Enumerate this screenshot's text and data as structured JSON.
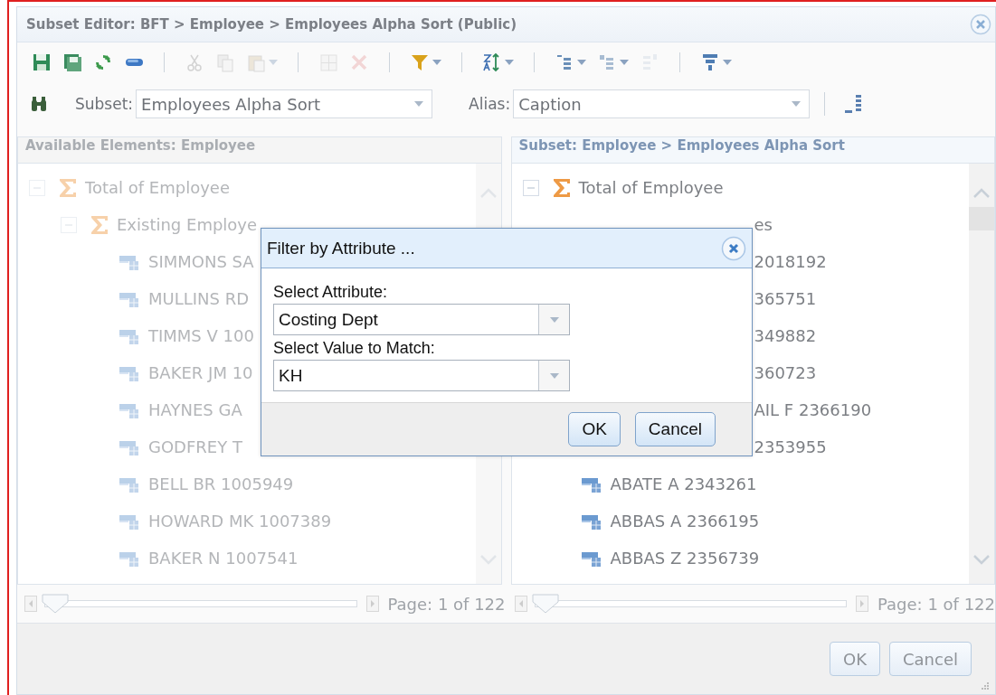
{
  "window": {
    "title": "Subset Editor: BFT > Employee > Employees Alpha Sort (Public)"
  },
  "toolbar": [
    [
      {
        "disabled": false,
        "caret": false
      },
      {
        "disabled": false,
        "caret": false
      },
      {
        "disabled": false,
        "caret": false
      },
      {
        "disabled": false,
        "caret": false
      }
    ],
    [
      {
        "disabled": true,
        "caret": false
      },
      {
        "disabled": true,
        "caret": false
      },
      {
        "disabled": true,
        "caret": true
      }
    ],
    [
      {
        "disabled": true,
        "caret": false
      },
      {
        "disabled": true,
        "caret": false
      }
    ],
    [
      {
        "disabled": false,
        "caret": true
      }
    ],
    [
      {
        "disabled": false,
        "caret": true
      }
    ],
    [
      {
        "disabled": false,
        "caret": true
      },
      {
        "disabled": false,
        "caret": true
      },
      {
        "disabled": true,
        "caret": false
      }
    ],
    [
      {
        "disabled": false,
        "caret": true
      }
    ]
  ],
  "subset_row": {
    "subset_label": "Subset:",
    "subset_value": "Employees Alpha Sort",
    "alias_label": "Alias:",
    "alias_value": "Caption"
  },
  "panels": [
    {
      "title": "Available Elements: Employee",
      "disabled": true,
      "page": "Page: 1 of 122",
      "level": 0,
      "tree": [
        {
          "label": "Total of Employee",
          "kind": "consolidated",
          "expanded": true,
          "children": [
            {
              "label": "Existing Employe",
              "kind": "consolidated",
              "expanded": true,
              "children": [
                {
                  "label": "SIMMONS SA",
                  "kind": "leaf"
                },
                {
                  "label": "MULLINS RD",
                  "kind": "leaf"
                },
                {
                  "label": "TIMMS V 100",
                  "kind": "leaf"
                },
                {
                  "label": "BAKER JM 10",
                  "kind": "leaf"
                },
                {
                  "label": "HAYNES GA",
                  "kind": "leaf"
                },
                {
                  "label": "GODFREY T",
                  "kind": "leaf"
                },
                {
                  "label": "BELL BR 1005949",
                  "kind": "leaf"
                },
                {
                  "label": "HOWARD MK 1007389",
                  "kind": "leaf"
                },
                {
                  "label": "BAKER N 1007541",
                  "kind": "leaf"
                }
              ]
            }
          ]
        }
      ]
    },
    {
      "title": "Subset: Employee > Employees Alpha Sort",
      "disabled": false,
      "page": "Page: 1 of 122",
      "level": 0,
      "tree": [
        {
          "label": "Total of Employee",
          "kind": "consolidated",
          "expanded": true,
          "children": [
            {
              "label": "es",
              "kind": "partial"
            },
            {
              "label": "2018192",
              "kind": "partial"
            },
            {
              "label": "365751",
              "kind": "partial"
            },
            {
              "label": "349882",
              "kind": "partial"
            },
            {
              "label": "360723",
              "kind": "partial"
            },
            {
              "label": "AIL F 2366190",
              "kind": "partial"
            },
            {
              "label": "2353955",
              "kind": "partial"
            },
            {
              "label": "ABATE A 2343261",
              "kind": "leaf"
            },
            {
              "label": "ABBAS A 2366195",
              "kind": "leaf"
            },
            {
              "label": "ABBAS Z 2356739",
              "kind": "leaf"
            }
          ]
        }
      ]
    }
  ],
  "buttons": [
    "OK",
    "Cancel"
  ],
  "dialog": {
    "title": "Filter by Attribute ...",
    "fields": [
      {
        "label": "Select Attribute:",
        "value": "Costing Dept"
      },
      {
        "label": "Select Value to Match:",
        "value": "KH"
      }
    ],
    "buttons": [
      "OK",
      "Cancel"
    ]
  }
}
